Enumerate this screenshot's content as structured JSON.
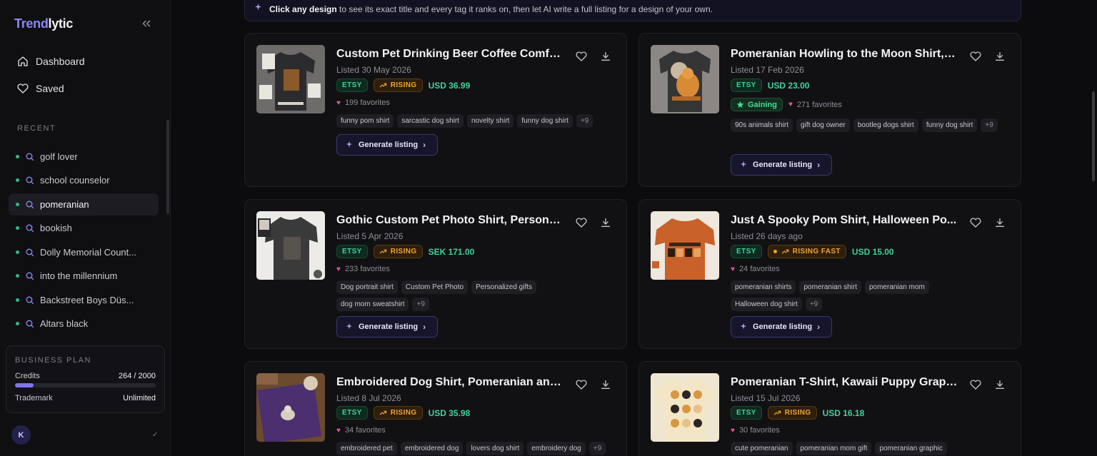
{
  "app": {
    "logo_a": "Trend",
    "logo_b": "lytic"
  },
  "nav": [
    {
      "label": "Dashboard",
      "icon": "home-icon"
    },
    {
      "label": "Saved",
      "icon": "heart-icon"
    }
  ],
  "recent": {
    "label": "RECENT",
    "items": [
      {
        "label": "golf lover"
      },
      {
        "label": "school counselor"
      },
      {
        "label": "pomeranian",
        "active": true
      },
      {
        "label": "bookish"
      },
      {
        "label": "Dolly Memorial Count..."
      },
      {
        "label": "into the millennium"
      },
      {
        "label": "Backstreet Boys Düs..."
      },
      {
        "label": "Altars black"
      }
    ]
  },
  "plan": {
    "title": "BUSINESS PLAN",
    "credits_label": "Credits",
    "credits_value": "264 / 2000",
    "credits_fraction": 0.132,
    "trademark_label": "Trademark",
    "trademark_value": "Unlimited"
  },
  "user": {
    "initial": "K",
    "check": "✓"
  },
  "banner": {
    "bold": "Click any design",
    "rest": " to see its exact title and every tag it ranks on, then let AI write a full listing for a design of your own."
  },
  "cards": [
    {
      "title": "Custom Pet Drinking Beer Coffee Comfor...",
      "listed": "Listed 30 May 2026",
      "platform": "ETSY",
      "trend": "RISING",
      "price": "USD 36.99",
      "favorites": "199 favorites",
      "tags": [
        "funny pom shirt",
        "sarcastic dog shirt",
        "novelty shirt",
        "funny dog shirt"
      ],
      "more": "+9",
      "cta": "Generate listing"
    },
    {
      "title": "Pomeranian Howling to the Moon Shirt, V...",
      "listed": "Listed 17 Feb 2026",
      "platform": "ETSY",
      "price": "USD 23.00",
      "trend": "Gaining",
      "favorites": "271 favorites",
      "tags": [
        "90s animals shirt",
        "gift dog owner",
        "bootleg dogs shirt",
        "funny dog shirt"
      ],
      "more": "+9",
      "cta": "Generate listing"
    },
    {
      "title": "Gothic Custom Pet Photo Shirt, Personali...",
      "listed": "Listed 5 Apr 2026",
      "platform": "ETSY",
      "trend": "RISING",
      "price": "SEK 171.00",
      "favorites": "233 favorites",
      "tags": [
        "Dog portrait shirt",
        "Custom Pet Photo",
        "Personalized gifts",
        "dog mom sweatshirt"
      ],
      "more": "+9",
      "cta": "Generate listing"
    },
    {
      "title": "Just A Spooky Pom Shirt, Halloween Po...",
      "listed": "Listed 26 days ago",
      "platform": "ETSY",
      "trend": "RISING FAST",
      "price": "USD 15.00",
      "favorites": "24 favorites",
      "tags": [
        "pomeranian shirts",
        "pomeranian shirt",
        "pomeranian mom",
        "Halloween dog shirt"
      ],
      "more": "+9",
      "cta": "Generate listing"
    },
    {
      "title": "Embroidered Dog Shirt, Pomeranian and ...",
      "listed": "Listed 8 Jul 2026",
      "platform": "ETSY",
      "trend": "RISING",
      "price": "USD 35.98",
      "favorites": "34 favorites",
      "tags": [
        "embroidered pet",
        "embroidered dog",
        "lovers dog shirt",
        "embroidery dog"
      ],
      "more": "+9"
    },
    {
      "title": "Pomeranian T-Shirt, Kawaii Puppy Graphi...",
      "listed": "Listed 15 Jul 2026",
      "platform": "ETSY",
      "trend": "RISING",
      "price": "USD 16.18",
      "favorites": "30 favorites",
      "tags": [
        "cute pomeranian",
        "pomeranian mom gift",
        "pomeranian graphic"
      ]
    }
  ],
  "colors": {
    "accent": "#8b87f0",
    "etsy": "#3fd39a",
    "rising": "#f2a33a",
    "favorite": "#e0559a"
  }
}
